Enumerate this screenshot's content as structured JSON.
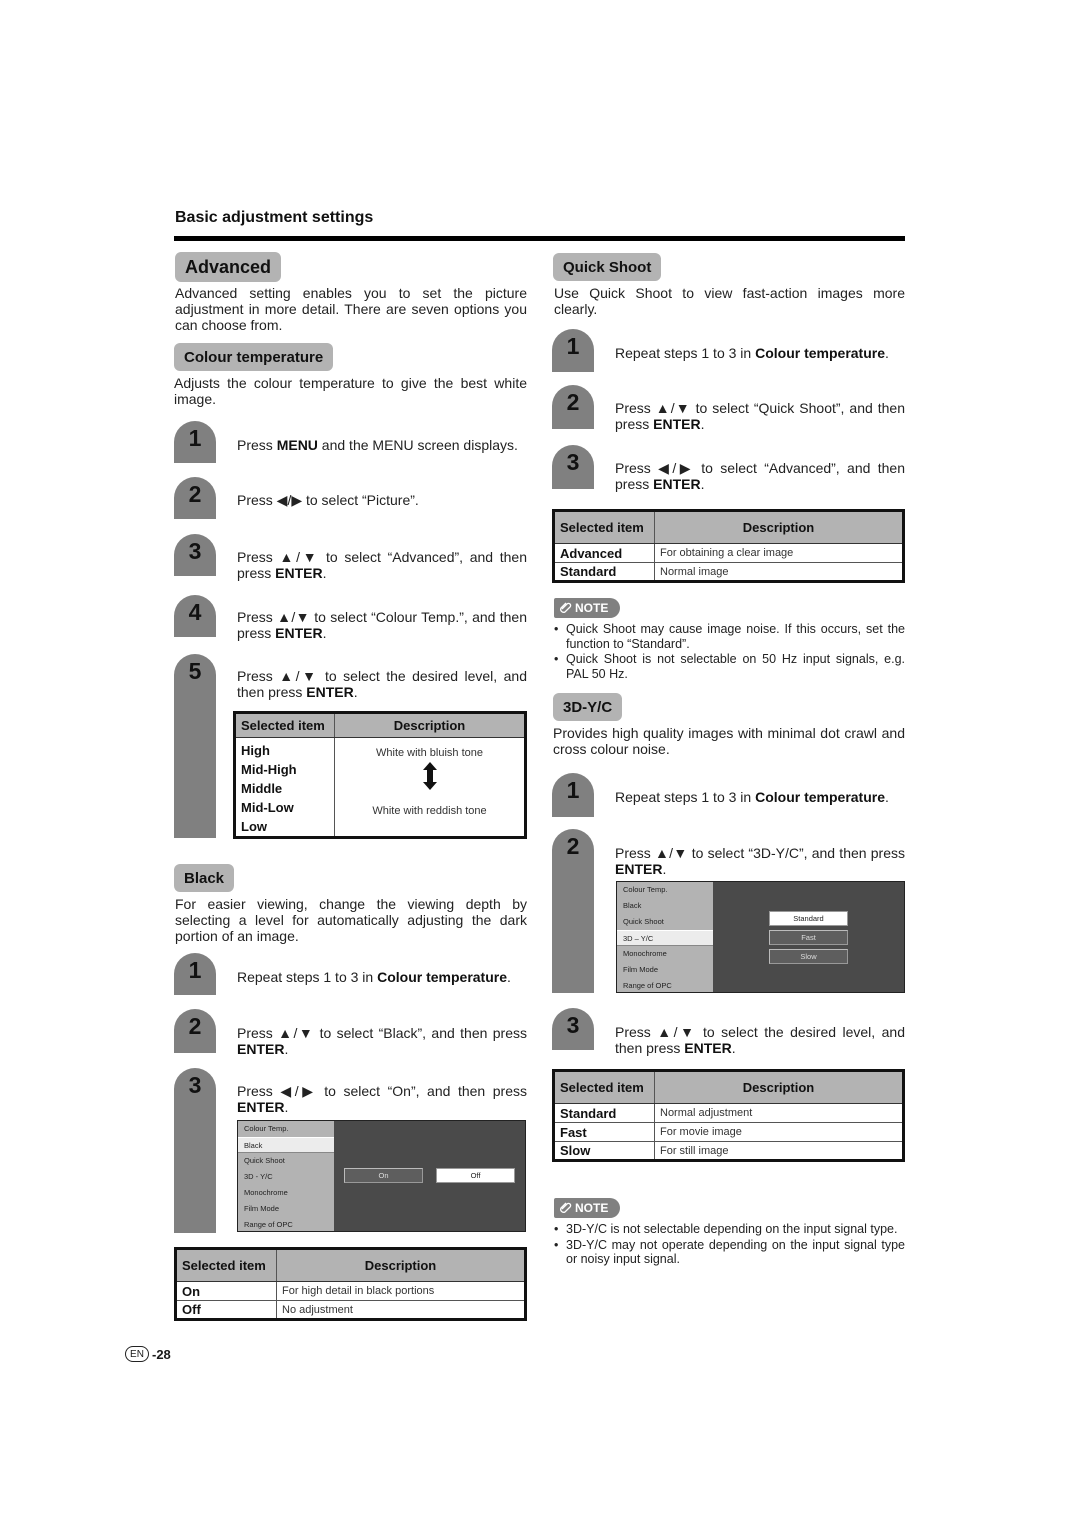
{
  "header": {
    "title": "Basic adjustment settings"
  },
  "advanced": {
    "title": "Advanced",
    "intro": "Advanced setting enables you to set the picture adjustment in more detail.  There are seven options you can choose from."
  },
  "colour_temp": {
    "title": "Colour temperature",
    "intro": "Adjusts the colour temperature to give the best white image.",
    "steps": [
      {
        "num": "1",
        "pre": "Press ",
        "bold": "MENU",
        "post": " and the MENU screen displays."
      },
      {
        "num": "2",
        "pre": "Press ◀/▶ to select “Picture”.",
        "bold": "",
        "post": ""
      },
      {
        "num": "3",
        "pre": "Press ▲/▼ to select “Advanced”, and then press ",
        "bold": "ENTER",
        "post": "."
      },
      {
        "num": "4",
        "pre": "Press ▲/▼ to select “Colour Temp.”, and then press ",
        "bold": "ENTER",
        "post": "."
      },
      {
        "num": "5",
        "pre": "Press ▲/▼ to select the desired level, and then press ",
        "bold": "ENTER",
        "post": "."
      }
    ],
    "table": {
      "headers": [
        "Selected item",
        "Description"
      ],
      "items": [
        "High",
        "Mid-High",
        "Middle",
        "Mid-Low",
        "Low"
      ],
      "desc_top": "White with bluish tone",
      "desc_bottom": "White with reddish tone",
      "arrow_icon": "double-vertical-arrow"
    }
  },
  "black": {
    "title": "Black",
    "intro": "For easier viewing, change the viewing depth by selecting a level for automatically adjusting the dark portion of an image.",
    "steps": [
      {
        "num": "1",
        "pre": "Repeat steps 1 to 3 in ",
        "bold": "Colour temperature",
        "post": "."
      },
      {
        "num": "2",
        "pre": "Press ▲/▼ to select “Black”, and then press ",
        "bold": "ENTER",
        "post": "."
      },
      {
        "num": "3",
        "pre": "Press ◀/▶ to select “On”, and then press ",
        "bold": "ENTER",
        "post": "."
      }
    ],
    "screen": {
      "menu": [
        "Colour Temp.",
        "Black",
        "Quick Shoot",
        "3D - Y/C",
        "Monochrome",
        "Film Mode",
        "Range of OPC"
      ],
      "selected_menu": "Black",
      "options": [
        "On",
        "Off"
      ],
      "highlighted_option": "Off"
    },
    "table": {
      "headers": [
        "Selected item",
        "Description"
      ],
      "rows": [
        {
          "item": "On",
          "desc": "For high detail in black portions"
        },
        {
          "item": "Off",
          "desc": "No adjustment"
        }
      ]
    }
  },
  "quick_shoot": {
    "title": "Quick Shoot",
    "intro": "Use Quick Shoot to view fast-action images more clearly.",
    "steps": [
      {
        "num": "1",
        "pre": "Repeat steps 1 to 3 in ",
        "bold": "Colour temperature",
        "post": "."
      },
      {
        "num": "2",
        "pre": "Press ▲/▼ to select “Quick Shoot”, and then press ",
        "bold": "ENTER",
        "post": "."
      },
      {
        "num": "3",
        "pre": "Press ◀/▶ to select “Advanced”, and then press ",
        "bold": "ENTER",
        "post": "."
      }
    ],
    "table": {
      "headers": [
        "Selected item",
        "Description"
      ],
      "rows": [
        {
          "item": "Advanced",
          "desc": "For obtaining a clear image"
        },
        {
          "item": "Standard",
          "desc": "Normal image"
        }
      ]
    },
    "note_label": "NOTE",
    "notes": [
      "Quick Shoot may cause image noise. If this occurs, set the function to “Standard”.",
      "Quick Shoot is not selectable on 50 Hz input signals, e.g. PAL 50 Hz."
    ]
  },
  "yc3d": {
    "title": "3D-Y/C",
    "intro": "Provides high quality images with minimal dot crawl and cross colour noise.",
    "steps": [
      {
        "num": "1",
        "pre": "Repeat steps 1 to 3 in ",
        "bold": "Colour temperature",
        "post": "."
      },
      {
        "num": "2",
        "pre": "Press ▲/▼ to select “3D-Y/C”, and then press ",
        "bold": "ENTER",
        "post": "."
      },
      {
        "num": "3",
        "pre": "Press ▲/▼ to select the desired level, and then press ",
        "bold": "ENTER",
        "post": "."
      }
    ],
    "screen": {
      "menu": [
        "Colour Temp.",
        "Black",
        "Quick Shoot",
        "3D – Y/C",
        "Monochrome",
        "Film Mode",
        "Range of OPC"
      ],
      "selected_menu": "3D – Y/C",
      "options": [
        "Standard",
        "Fast",
        "Slow"
      ],
      "highlighted_option": "Standard"
    },
    "table": {
      "headers": [
        "Selected item",
        "Description"
      ],
      "rows": [
        {
          "item": "Standard",
          "desc": "Normal adjustment"
        },
        {
          "item": "Fast",
          "desc": "For movie image"
        },
        {
          "item": "Slow",
          "desc": "For still image"
        }
      ]
    },
    "note_label": "NOTE",
    "notes": [
      "3D-Y/C is not selectable depending on the input signal type.",
      "3D-Y/C may not operate depending on the input signal type or noisy input signal."
    ]
  },
  "footer": {
    "lang": "EN",
    "page": "-28"
  }
}
